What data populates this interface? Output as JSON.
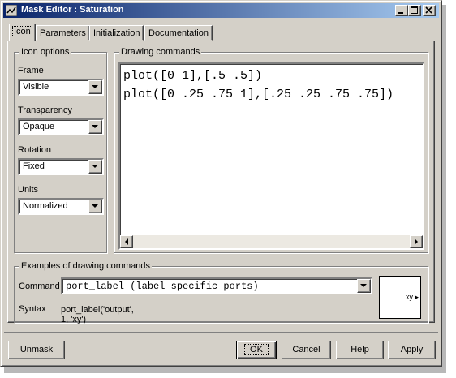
{
  "window": {
    "title": "Mask Editor : Saturation"
  },
  "tabs": [
    {
      "label": "Icon"
    },
    {
      "label": "Parameters"
    },
    {
      "label": "Initialization"
    },
    {
      "label": "Documentation"
    }
  ],
  "icon_options": {
    "legend": "Icon options",
    "frame": {
      "label": "Frame",
      "value": "Visible"
    },
    "transparency": {
      "label": "Transparency",
      "value": "Opaque"
    },
    "rotation": {
      "label": "Rotation",
      "value": "Fixed"
    },
    "units": {
      "label": "Units",
      "value": "Normalized"
    }
  },
  "drawing_commands": {
    "legend": "Drawing commands",
    "lines": [
      "plot([0 1],[.5 .5])",
      "plot([0 .25 .75 1],[.25 .25 .75 .75])"
    ]
  },
  "examples": {
    "legend": "Examples of drawing commands",
    "command_label": "Command",
    "command_value": "port_label (label specific ports)",
    "syntax_label": "Syntax",
    "syntax_value": "port_label('output', 1, 'xy')",
    "preview_port_text": "xy"
  },
  "buttons": {
    "unmask": "Unmask",
    "ok": "OK",
    "cancel": "Cancel",
    "help": "Help",
    "apply": "Apply"
  },
  "colors": {
    "titlebar_start": "#0a246a",
    "titlebar_end": "#a6caf0",
    "face": "#d4d0c8"
  }
}
